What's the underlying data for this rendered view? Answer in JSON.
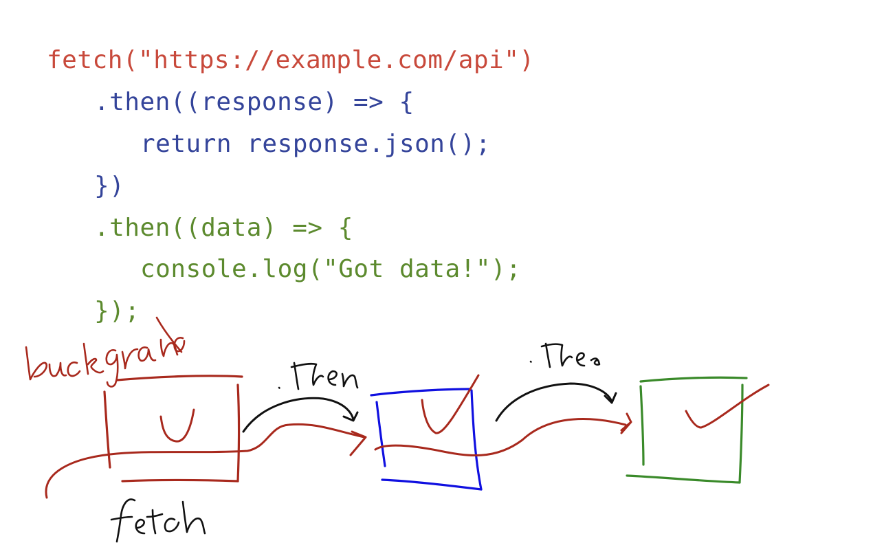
{
  "code": {
    "lines": [
      {
        "text": "fetch(\"https://example.com/api\")",
        "color": "#c8493b"
      },
      {
        "text": ".then((response) => {",
        "color": "#34449a"
      },
      {
        "text": "return response.json();",
        "color": "#34449a"
      },
      {
        "text": "})",
        "color": "#34449a"
      },
      {
        "text": ".then((data) => {",
        "color": "#5c8a2e"
      },
      {
        "text": "console.log(\"Got data!\");",
        "color": "#5c8a2e"
      },
      {
        "text": "});",
        "color": "#5c8a2e"
      }
    ]
  },
  "annotations": {
    "background_label": "background",
    "then_label_1": ".then",
    "then_label_2": ".then",
    "fetch_label": "fetch"
  },
  "colors": {
    "fetch_box": "#a8291d",
    "first_then_box": "#1010e0",
    "second_then_box": "#3a8a2a",
    "flow_line": "#a8291d",
    "arrows": "#111111",
    "checkmarks": "#a8291d"
  }
}
